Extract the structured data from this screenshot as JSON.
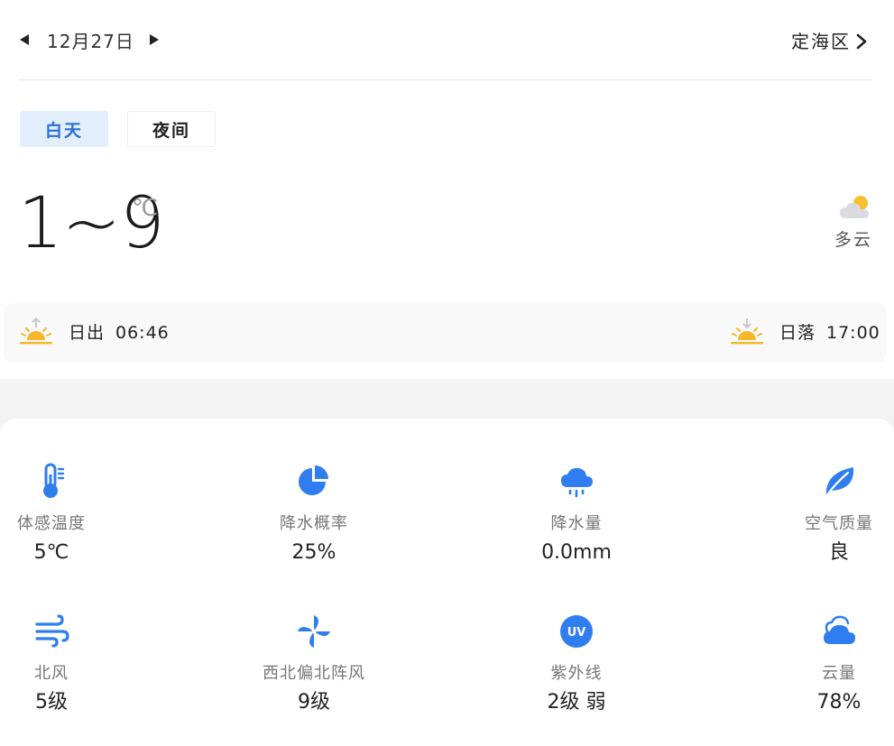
{
  "header": {
    "date": "12月27日",
    "district": "定海区"
  },
  "tabs": [
    {
      "label": "白天",
      "active": true
    },
    {
      "label": "夜间",
      "active": false
    }
  ],
  "current": {
    "temp_range": "1~9",
    "temp_unit": "℃",
    "condition": "多云",
    "condition_icon": "partly-cloudy-icon"
  },
  "sun": {
    "sunrise_label": "日出",
    "sunrise_time": "06:46",
    "sunset_label": "日落",
    "sunset_time": "17:00"
  },
  "metrics": [
    {
      "label": "体感温度",
      "value": "5℃",
      "icon": "thermometer-icon"
    },
    {
      "label": "降水概率",
      "value": "25%",
      "icon": "pie-chart-icon"
    },
    {
      "label": "降水量",
      "value": "0.0mm",
      "icon": "rain-cloud-icon"
    },
    {
      "label": "空气质量",
      "value": "良",
      "icon": "leaf-icon"
    },
    {
      "label": "北风",
      "value": "5级",
      "icon": "wind-icon"
    },
    {
      "label": "西北偏北阵风",
      "value": "9级",
      "icon": "pinwheel-icon"
    },
    {
      "label": "紫外线",
      "value": "2级 弱",
      "icon": "uv-icon"
    },
    {
      "label": "云量",
      "value": "78%",
      "icon": "cloud-icon"
    }
  ],
  "colors": {
    "accent": "#2f7ef0",
    "tab_active_bg": "#e3eefc",
    "sun_yellow": "#f5b72a"
  }
}
